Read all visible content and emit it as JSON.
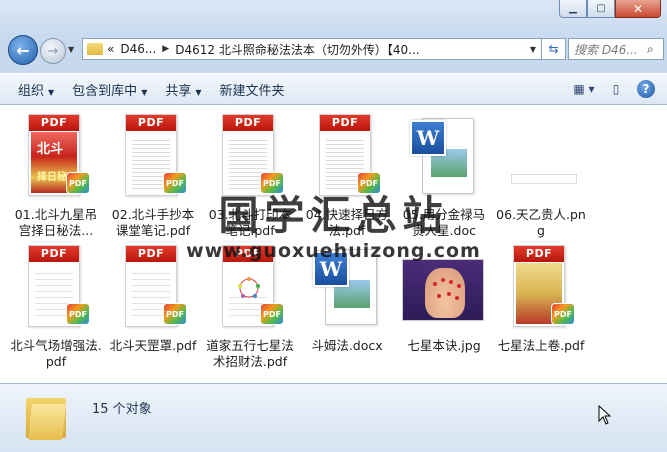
{
  "window": {
    "address": {
      "crumbs": [
        "«",
        "D46...",
        "D4612 北斗照命秘法法本（切勿外传）【40..."
      ]
    },
    "search_placeholder": "搜索 D46..."
  },
  "toolbar": {
    "organize": "组织",
    "include_library": "包含到库中",
    "share": "共享",
    "new_folder": "新建文件夹"
  },
  "files": [
    {
      "name": "01.北斗九星吊宫择日秘法...",
      "type": "pdf-cover",
      "cover_text": [
        "北斗",
        "择日秘"
      ]
    },
    {
      "name": "02.北斗手抄本课堂笔记.pdf",
      "type": "pdf"
    },
    {
      "name": "03.北斗打印本笔记.pdf",
      "type": "pdf"
    },
    {
      "name": "04.快速择日方法.pdf",
      "type": "pdf"
    },
    {
      "name": "05.用分金禄马贵人星.doc",
      "type": "doc"
    },
    {
      "name": "06.天乙贵人.png",
      "type": "png"
    },
    {
      "name": "北斗气场增强法.pdf",
      "type": "pdf"
    },
    {
      "name": "北斗天罡罩.pdf",
      "type": "pdf"
    },
    {
      "name": "道家五行七星法术招财法.pdf",
      "type": "pdf-yantra"
    },
    {
      "name": "斗姆法.docx",
      "type": "doc"
    },
    {
      "name": "七星本诀.jpg",
      "type": "jpg"
    },
    {
      "name": "七星法上卷.pdf",
      "type": "pdf-color"
    }
  ],
  "badges": {
    "pdf": "PDF",
    "word": "W"
  },
  "watermark": {
    "line1": "国学汇总站",
    "line2": "www.guoxuehuizong.com"
  },
  "status": {
    "count": "15 个对象"
  }
}
